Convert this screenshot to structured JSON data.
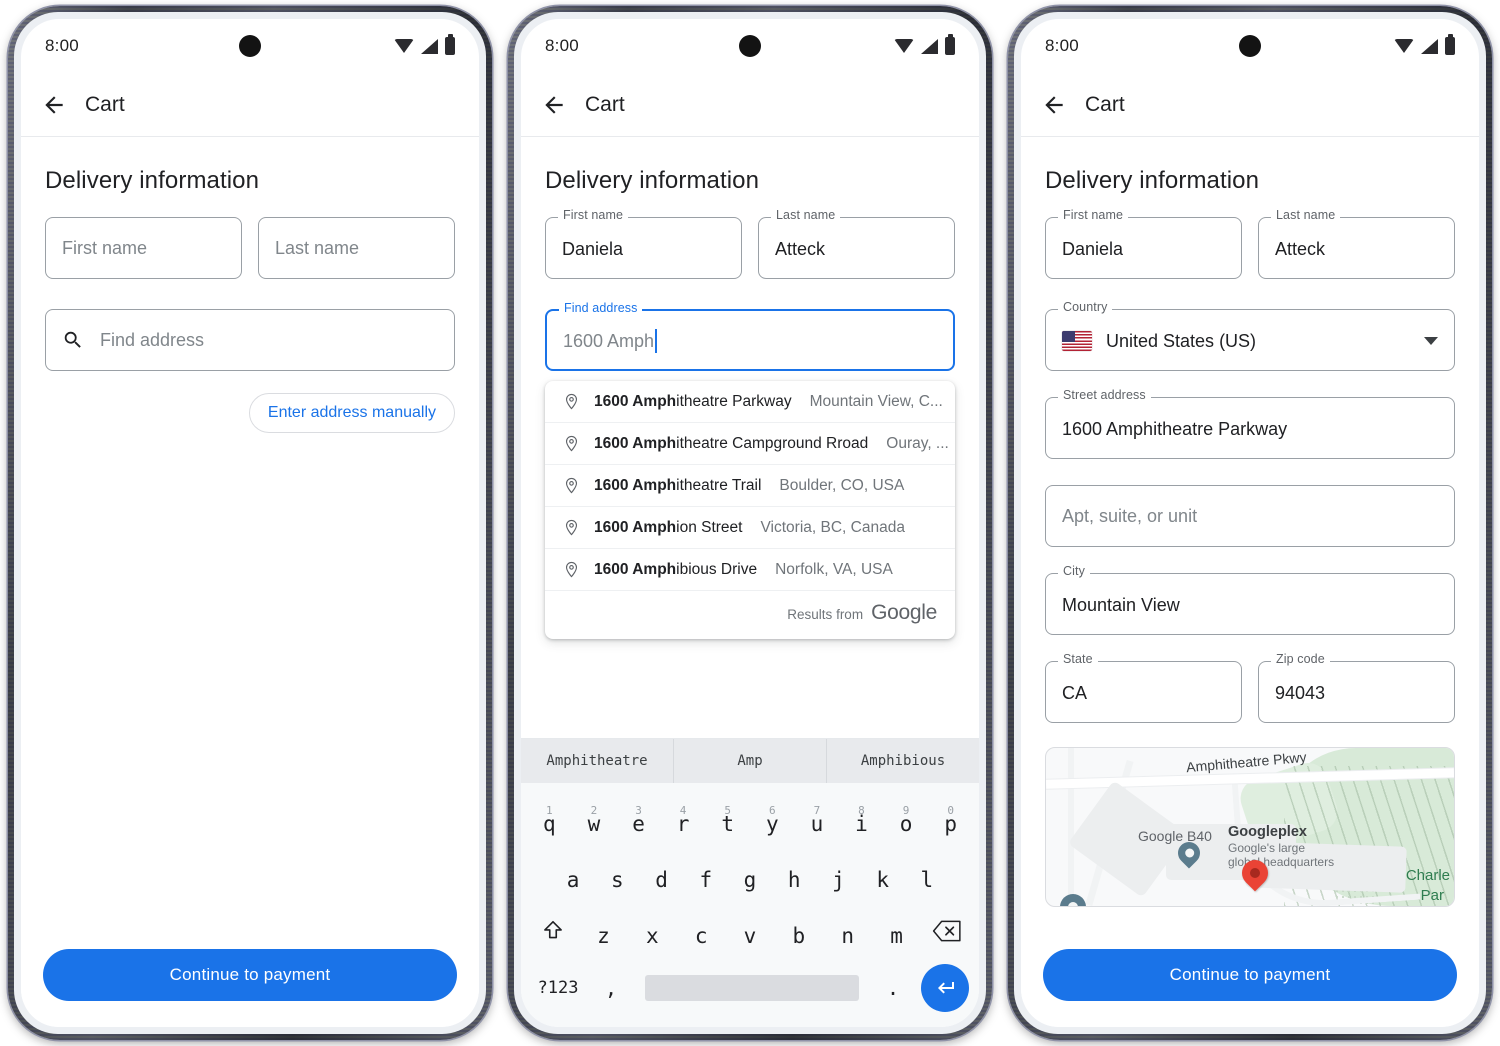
{
  "status_bar": {
    "time": "8:00",
    "icons": [
      "wifi-icon",
      "cell-signal-icon",
      "battery-icon"
    ]
  },
  "app_bar": {
    "title": "Cart",
    "back_icon": "back-arrow-icon"
  },
  "section": {
    "title": "Delivery information"
  },
  "colors": {
    "accent": "#1a73e8",
    "border": "#9aa0a6",
    "label": "#5f6368",
    "text": "#202124",
    "placeholder": "#80868b"
  },
  "cta": {
    "label": "Continue to payment"
  },
  "screen1": {
    "first_name": {
      "label": "First name",
      "placeholder": "First name",
      "value": ""
    },
    "last_name": {
      "label": "Last name",
      "placeholder": "Last name",
      "value": ""
    },
    "find_address": {
      "label": "Find address",
      "placeholder": "Find address",
      "value": "",
      "icon": "search-icon"
    },
    "manual_chip": {
      "label": "Enter address manually"
    }
  },
  "screen2": {
    "first_name": {
      "label": "First name",
      "value": "Daniela"
    },
    "last_name": {
      "label": "Last name",
      "value": "Atteck"
    },
    "find_address": {
      "label": "Find address",
      "value": "1600 Amph",
      "focused": true
    },
    "suggestions": [
      {
        "bold": "1600 Amph",
        "rest": "itheatre Parkway",
        "secondary": "Mountain View, C..."
      },
      {
        "bold": "1600 Amph",
        "rest": "itheatre Campground Rroad",
        "secondary": "Ouray, ..."
      },
      {
        "bold": "1600 Amph",
        "rest": "itheatre Trail",
        "secondary": "Boulder, CO, USA"
      },
      {
        "bold": "1600 Amph",
        "rest": "ion Street",
        "secondary": "Victoria, BC, Canada"
      },
      {
        "bold": "1600 Amph",
        "rest": "ibious Drive",
        "secondary": "Norfolk, VA, USA"
      }
    ],
    "attribution": {
      "text": "Results from",
      "logo": "Google"
    },
    "keyboard": {
      "suggestions": [
        "Amphitheatre",
        "Amp",
        "Amphibious"
      ],
      "row1_nums": [
        "1",
        "2",
        "3",
        "4",
        "5",
        "6",
        "7",
        "8",
        "9",
        "0"
      ],
      "row1": [
        "q",
        "w",
        "e",
        "r",
        "t",
        "y",
        "u",
        "i",
        "o",
        "p"
      ],
      "row2": [
        "a",
        "s",
        "d",
        "f",
        "g",
        "h",
        "j",
        "k",
        "l"
      ],
      "row3": [
        "z",
        "x",
        "c",
        "v",
        "b",
        "n",
        "m"
      ],
      "shift_icon": "shift-key-icon",
      "backspace_icon": "backspace-key-icon",
      "symbols_key": "?123",
      "comma_key": ",",
      "period_key": ".",
      "space_key": "",
      "enter_icon": "enter-key-icon"
    }
  },
  "screen3": {
    "first_name": {
      "label": "First name",
      "value": "Daniela"
    },
    "last_name": {
      "label": "Last name",
      "value": "Atteck"
    },
    "country": {
      "label": "Country",
      "value": "United States (US)",
      "flag": "us-flag-icon",
      "chevron": "chevron-down-icon"
    },
    "street_address": {
      "label": "Street address",
      "value": "1600 Amphitheatre Parkway"
    },
    "apt": {
      "label": "",
      "placeholder": "Apt, suite, or unit",
      "value": ""
    },
    "city": {
      "label": "City",
      "value": "Mountain View"
    },
    "state": {
      "label": "State",
      "value": "CA"
    },
    "zip": {
      "label": "Zip code",
      "value": "94043"
    },
    "map": {
      "road_label": "Amphitheatre Pkwy",
      "building_label": "Google B40",
      "poi_title": "Googleplex",
      "poi_subtitle_line1": "Google's large",
      "poi_subtitle_line2": "global headquarters",
      "park_label_line1": "Charle",
      "park_label_line2": "Par",
      "markers": [
        "map-pin-red",
        "map-pin-blue",
        "map-pin-blue"
      ]
    }
  }
}
